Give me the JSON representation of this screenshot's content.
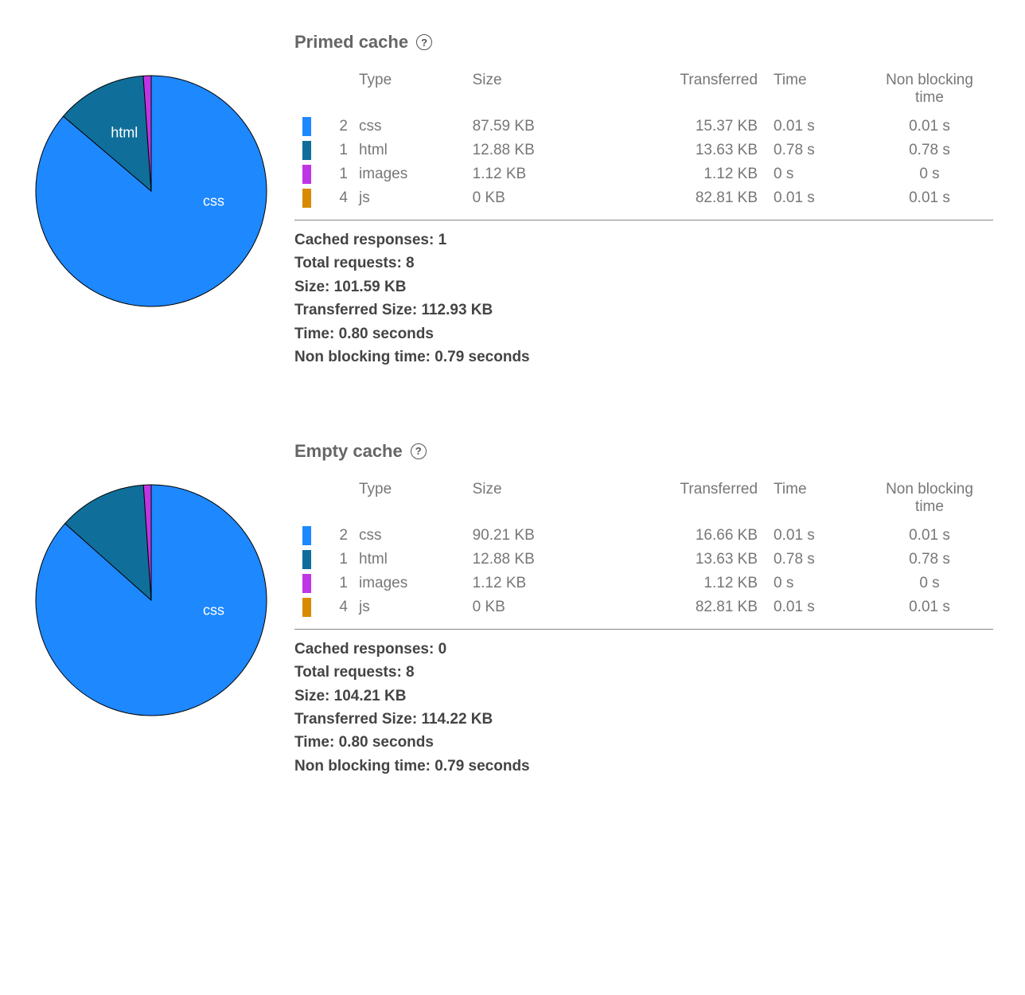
{
  "colors": {
    "css": "#1e88ff",
    "html": "#0f6f9a",
    "images": "#c035e3",
    "js": "#d98b00"
  },
  "table_headers": {
    "type": "Type",
    "size": "Size",
    "transferred": "Transferred",
    "time": "Time",
    "nonblocking": "Non blocking time"
  },
  "summary_labels": {
    "cached": "Cached responses:",
    "requests": "Total requests:",
    "size": "Size:",
    "transferred": "Transferred Size:",
    "time": "Time:",
    "nonblocking": "Non blocking time:"
  },
  "sections": [
    {
      "title": "Primed cache",
      "rows": [
        {
          "count": "2",
          "type": "css",
          "size": "87.59 KB",
          "transferred": "15.37 KB",
          "time": "0.01 s",
          "nbt": "0.01 s",
          "color": "#1e88ff"
        },
        {
          "count": "1",
          "type": "html",
          "size": "12.88 KB",
          "transferred": "13.63 KB",
          "time": "0.78 s",
          "nbt": "0.78 s",
          "color": "#0f6f9a"
        },
        {
          "count": "1",
          "type": "images",
          "size": "1.12 KB",
          "transferred": "1.12 KB",
          "time": "0 s",
          "nbt": "0 s",
          "color": "#c035e3"
        },
        {
          "count": "4",
          "type": "js",
          "size": "0 KB",
          "transferred": "82.81 KB",
          "time": "0.01 s",
          "nbt": "0.01 s",
          "color": "#d98b00"
        }
      ],
      "summary": {
        "cached": "1",
        "requests": "8",
        "size": "101.59 KB",
        "transferred": "112.93 KB",
        "time": "0.80 seconds",
        "nonblocking": "0.79 seconds"
      },
      "pie_labels": [
        {
          "text": "css",
          "angle": 100
        },
        {
          "text": "html",
          "angle": 335
        }
      ]
    },
    {
      "title": "Empty cache",
      "rows": [
        {
          "count": "2",
          "type": "css",
          "size": "90.21 KB",
          "transferred": "16.66 KB",
          "time": "0.01 s",
          "nbt": "0.01 s",
          "color": "#1e88ff"
        },
        {
          "count": "1",
          "type": "html",
          "size": "12.88 KB",
          "transferred": "13.63 KB",
          "time": "0.78 s",
          "nbt": "0.78 s",
          "color": "#0f6f9a"
        },
        {
          "count": "1",
          "type": "images",
          "size": "1.12 KB",
          "transferred": "1.12 KB",
          "time": "0 s",
          "nbt": "0 s",
          "color": "#c035e3"
        },
        {
          "count": "4",
          "type": "js",
          "size": "0 KB",
          "transferred": "82.81 KB",
          "time": "0.01 s",
          "nbt": "0.01 s",
          "color": "#d98b00"
        }
      ],
      "summary": {
        "cached": "0",
        "requests": "8",
        "size": "104.21 KB",
        "transferred": "114.22 KB",
        "time": "0.80 seconds",
        "nonblocking": "0.79 seconds"
      },
      "pie_labels": [
        {
          "text": "css",
          "angle": 100
        }
      ]
    }
  ],
  "chart_data": [
    {
      "type": "pie",
      "title": "Primed cache — Size by type",
      "series": [
        {
          "name": "css",
          "value": 87.59,
          "unit": "KB",
          "color": "#1e88ff"
        },
        {
          "name": "html",
          "value": 12.88,
          "unit": "KB",
          "color": "#0f6f9a"
        },
        {
          "name": "images",
          "value": 1.12,
          "unit": "KB",
          "color": "#c035e3"
        },
        {
          "name": "js",
          "value": 0,
          "unit": "KB",
          "color": "#d98b00"
        }
      ]
    },
    {
      "type": "pie",
      "title": "Empty cache — Size by type",
      "series": [
        {
          "name": "css",
          "value": 90.21,
          "unit": "KB",
          "color": "#1e88ff"
        },
        {
          "name": "html",
          "value": 12.88,
          "unit": "KB",
          "color": "#0f6f9a"
        },
        {
          "name": "images",
          "value": 1.12,
          "unit": "KB",
          "color": "#c035e3"
        },
        {
          "name": "js",
          "value": 0,
          "unit": "KB",
          "color": "#d98b00"
        }
      ]
    }
  ]
}
